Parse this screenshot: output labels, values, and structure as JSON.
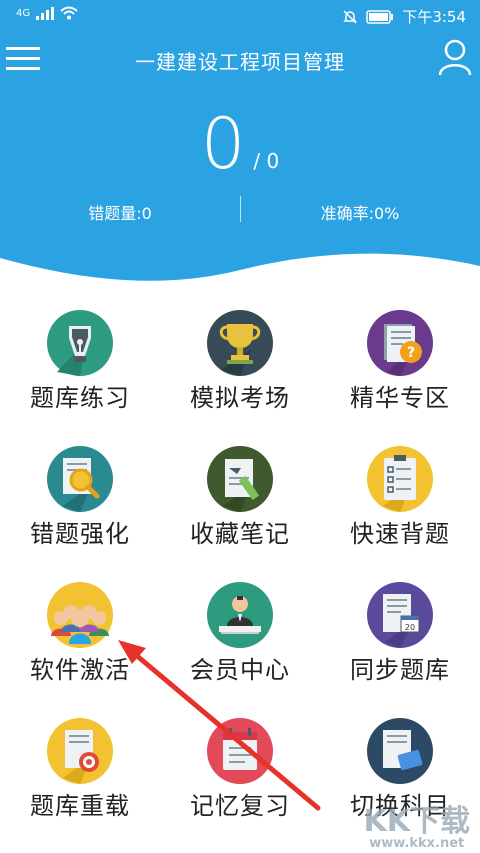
{
  "status_bar": {
    "network": "4G",
    "time": "下午3:54"
  },
  "header": {
    "title": "一建建设工程项目管理",
    "score": "0",
    "total": "/ 0",
    "wrong_count": "错题量:0",
    "accuracy": "准确率:0%",
    "bg_color": "#2ba3e3"
  },
  "tiles": [
    {
      "label": "题库练习",
      "icon": "pen-nib-icon"
    },
    {
      "label": "模拟考场",
      "icon": "trophy-icon"
    },
    {
      "label": "精华专区",
      "icon": "document-question-icon"
    },
    {
      "label": "错题强化",
      "icon": "document-magnifier-icon"
    },
    {
      "label": "收藏笔记",
      "icon": "notebook-pencil-icon"
    },
    {
      "label": "快速背题",
      "icon": "clipboard-checklist-icon"
    },
    {
      "label": "软件激活",
      "icon": "people-group-icon"
    },
    {
      "label": "会员中心",
      "icon": "member-desk-icon"
    },
    {
      "label": "同步题库",
      "icon": "document-calendar-icon"
    },
    {
      "label": "题库重载",
      "icon": "document-target-icon"
    },
    {
      "label": "记忆复习",
      "icon": "calendar-checklist-icon"
    },
    {
      "label": "切换科目",
      "icon": "document-keyboard-icon"
    }
  ],
  "watermark": {
    "logo": "KK下载",
    "url": "www.kkx.net"
  }
}
